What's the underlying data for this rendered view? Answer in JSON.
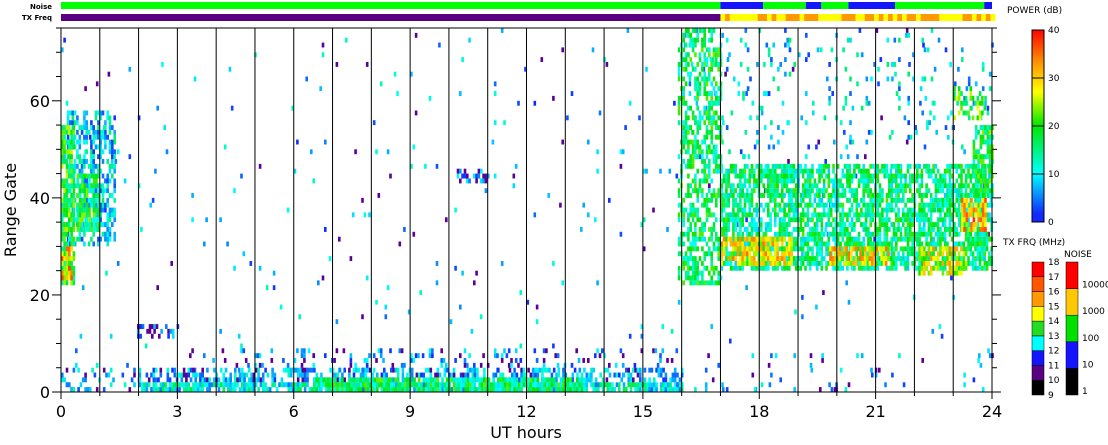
{
  "chart_data": {
    "type": "heatmap",
    "xlabel": "UT hours",
    "ylabel": "Range Gate",
    "xlim": [
      0,
      24
    ],
    "ylim": [
      0,
      75
    ],
    "x_ticks": [
      "0",
      "3",
      "6",
      "9",
      "12",
      "15",
      "18",
      "21",
      "24"
    ],
    "y_ticks": [
      "0",
      "20",
      "40",
      "60"
    ],
    "grid": "vertical lines every hour",
    "cell_hours": 0.06,
    "echo_regions": [
      {
        "t": [
          0,
          24
        ],
        "g": [
          0,
          75
        ],
        "power": 6,
        "density": 0.012
      },
      {
        "t": [
          16,
          24
        ],
        "g": [
          48,
          75
        ],
        "power": 9,
        "density": 0.07
      },
      {
        "t": [
          0,
          2
        ],
        "g": [
          0,
          5
        ],
        "power": 7,
        "density": 0.2
      },
      {
        "t": [
          2,
          16
        ],
        "g": [
          0,
          2
        ],
        "power": 11,
        "density": 0.8
      },
      {
        "t": [
          2,
          16
        ],
        "g": [
          2,
          5
        ],
        "power": 6,
        "density": 0.5
      },
      {
        "t": [
          6.5,
          13.5
        ],
        "g": [
          0,
          3
        ],
        "power": 16,
        "density": 0.8
      },
      {
        "t": [
          3,
          16
        ],
        "g": [
          5,
          9
        ],
        "power": 4,
        "density": 0.15
      },
      {
        "t": [
          16,
          24
        ],
        "g": [
          0,
          8
        ],
        "power": 5,
        "density": 0.05
      },
      {
        "t": [
          1.9,
          3.0
        ],
        "g": [
          11,
          14
        ],
        "power": 2,
        "density": 0.45
      },
      {
        "t": [
          0.15,
          1.4
        ],
        "g": [
          30,
          58
        ],
        "power": 9,
        "density": 0.55
      },
      {
        "t": [
          0.4,
          1.0
        ],
        "g": [
          33,
          45
        ],
        "power": 17,
        "density": 0.7
      },
      {
        "t": [
          0,
          0.35
        ],
        "g": [
          22,
          55
        ],
        "power": 19,
        "density": 0.8
      },
      {
        "t": [
          0,
          0.3
        ],
        "g": [
          23,
          30
        ],
        "power": 30,
        "density": 0.8
      },
      {
        "t": [
          10.2,
          11.0
        ],
        "g": [
          43,
          46
        ],
        "power": 3,
        "density": 0.5
      },
      {
        "t": [
          15.9,
          17
        ],
        "g": [
          22,
          75
        ],
        "power": 16,
        "density": 0.5
      },
      {
        "t": [
          17,
          24
        ],
        "g": [
          25,
          47
        ],
        "power": 15,
        "density": 0.7
      },
      {
        "t": [
          17,
          18.8
        ],
        "g": [
          26,
          32
        ],
        "power": 28,
        "density": 0.75
      },
      {
        "t": [
          19.8,
          21.3
        ],
        "g": [
          26,
          30
        ],
        "power": 28,
        "density": 0.75
      },
      {
        "t": [
          22.1,
          23.3
        ],
        "g": [
          24,
          30
        ],
        "power": 27,
        "density": 0.75
      },
      {
        "t": [
          23.2,
          23.8
        ],
        "g": [
          33,
          40
        ],
        "power": 31,
        "density": 0.7
      },
      {
        "t": [
          23.5,
          24
        ],
        "g": [
          40,
          55
        ],
        "power": 17,
        "density": 0.7
      },
      {
        "t": [
          23.0,
          23.8
        ],
        "g": [
          56,
          63
        ],
        "power": 20,
        "density": 0.4
      }
    ],
    "noise_segments": [
      [
        0,
        17,
        100
      ],
      [
        17,
        18.1,
        10
      ],
      [
        18.1,
        19.2,
        100
      ],
      [
        19.2,
        19.6,
        10
      ],
      [
        19.6,
        20.3,
        100
      ],
      [
        20.3,
        21.5,
        10
      ],
      [
        21.5,
        23.8,
        100
      ],
      [
        23.8,
        24,
        10
      ]
    ],
    "txfreq_segments": [
      [
        0,
        17,
        10
      ],
      [
        17,
        24,
        14.5
      ]
    ]
  },
  "labels": {
    "noise": "Noise",
    "tx_freq": "TX Freq"
  },
  "colorbars": {
    "power": {
      "title": "POWER (dB)",
      "ticks": [
        "0",
        "10",
        "20",
        "30",
        "40"
      ]
    },
    "txfreq": {
      "title": "TX FRQ (MHz)",
      "ticks": [
        "9",
        "10",
        "11",
        "12",
        "13",
        "14",
        "15",
        "16",
        "17",
        "18"
      ],
      "colors": [
        "#000000",
        "#5a0082",
        "#1414ff",
        "#00ffff",
        "#22dd22",
        "#ffff00",
        "#ff9900",
        "#ff5500",
        "#ff0000"
      ]
    },
    "noise": {
      "title": "NOISE",
      "ticks": [
        "1",
        "10",
        "100",
        "1000",
        "10000"
      ],
      "colors": [
        "#000000",
        "#1414ff",
        "#00e000",
        "#ffc800",
        "#ff0000"
      ]
    }
  }
}
